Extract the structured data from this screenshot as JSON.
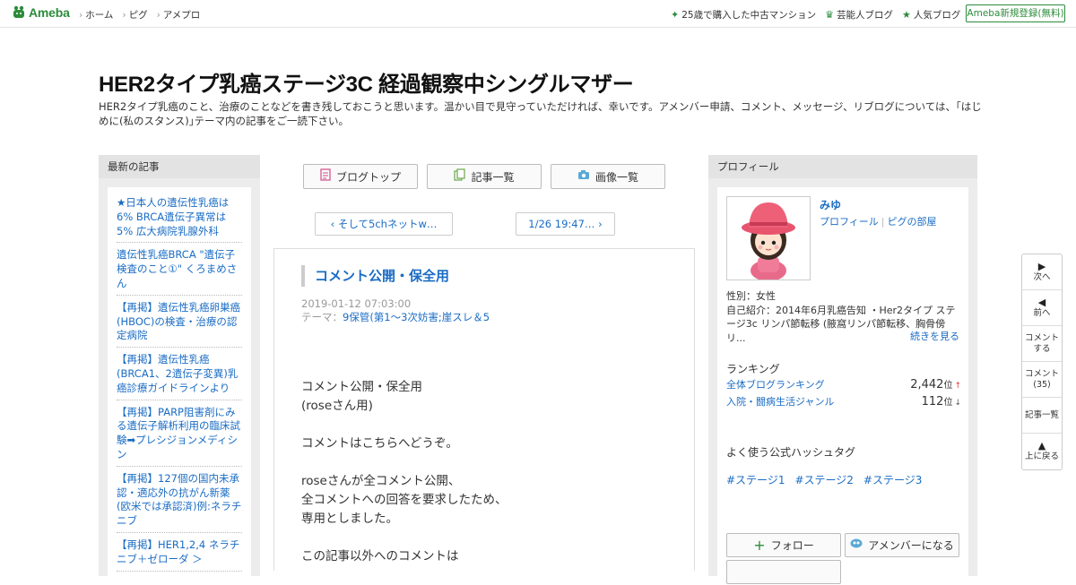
{
  "topbar": {
    "logo": "Ameba",
    "nav": [
      "ホーム",
      "ピグ",
      "アメプロ"
    ],
    "right_links": [
      {
        "icon": "sparkle-icon",
        "label": "25歳で購入した中古マンション"
      },
      {
        "icon": "crown-icon",
        "label": "芸能人ブログ"
      },
      {
        "icon": "star-icon",
        "label": "人気ブログ"
      }
    ],
    "register": "Ameba新規登録(無料)"
  },
  "header": {
    "title": "HER2タイプ乳癌ステージ3C 経過観察中シングルマザー",
    "description": "HER2タイプ乳癌のこと、治療のことなどを書き残しておこうと思います。温かい目で見守っていただければ、幸いです。アメンバー申請、コメント、メッセージ、リブログについては、｢はじめに(私のスタンス)｣テーマ内の記事をご一読下さい。"
  },
  "left": {
    "heading": "最新の記事",
    "items": [
      "★日本人の遺伝性乳癌は6% BRCA遺伝子異常は5% 広大病院乳腺外科",
      "遺伝性乳癌BRCA \"遺伝子検査のこと①\" くろまめさん",
      "【再掲】遺伝性乳癌卵巣癌(HBOC)の検査・治療の認定病院",
      "【再掲】遺伝性乳癌(BRCA1、2遺伝子変異)乳癌診療ガイドラインより",
      "【再掲】PARP阻害剤にみる遺伝子解析利用の臨床試験➡プレシジョンメディシン",
      "【再掲】127個の国内未承認・適応外の抗がん新薬(欧米では承認済)例:ネラチニブ",
      "【再掲】HER1,2,4 ネラチニブ＋ゼローダ ＞"
    ]
  },
  "center": {
    "buttons": [
      {
        "icon": "document-icon",
        "label": "ブログトップ"
      },
      {
        "icon": "list-icon",
        "label": "記事一覧"
      },
      {
        "icon": "camera-icon",
        "label": "画像一覧"
      }
    ],
    "prev": "そして5chネットw…",
    "next": "1/26 19:47…",
    "entry": {
      "title": "コメント公開・保全用",
      "date": "2019-01-12 07:03:00",
      "theme_label": "テーマ：",
      "theme": "9保管(第1～3次妨害;崖スレ＆5",
      "body": [
        [
          "コメント公開・保全用",
          "(roseさん用)"
        ],
        [
          "コメントはこちらへどうぞ。"
        ],
        [
          "roseさんが全コメント公開、",
          "全コメントへの回答を要求したため、",
          "専用としました。"
        ],
        [
          "この記事以外へのコメントは"
        ]
      ]
    }
  },
  "right": {
    "heading": "プロフィール",
    "name": "みゆ",
    "link_profile": "プロフィール",
    "link_pig": "ピグの部屋",
    "gender": "性別：女性",
    "intro": "自己紹介：2014年6月乳癌告知 ・Her2タイプ ステージ3c リンパ節転移 (腋窩リンパ節転移、胸骨傍リ...",
    "readmore": "続きを見る",
    "ranking_heading": "ランキング",
    "ranking": [
      {
        "label": "全体ブログランキング",
        "value": "2,442",
        "unit": "位",
        "trend": "↑"
      },
      {
        "label": "入院・闘病生活ジャンル",
        "value": "112",
        "unit": "位",
        "trend": "↓"
      }
    ],
    "hashtag_heading": "よく使う公式ハッシュタグ",
    "hashtags": [
      "#ステージ1",
      "#ステージ2",
      "#ステージ3"
    ],
    "follow": "フォロー",
    "amember": "アメンバーになる"
  },
  "sidenav": {
    "next": "次へ",
    "prev": "前へ",
    "comment": "コメントする",
    "comment_count": "コメント(35)",
    "list": "記事一覧",
    "top": "上に戻る"
  },
  "colors": {
    "accent": "#2d8c3c",
    "link": "#1a6cc4"
  }
}
